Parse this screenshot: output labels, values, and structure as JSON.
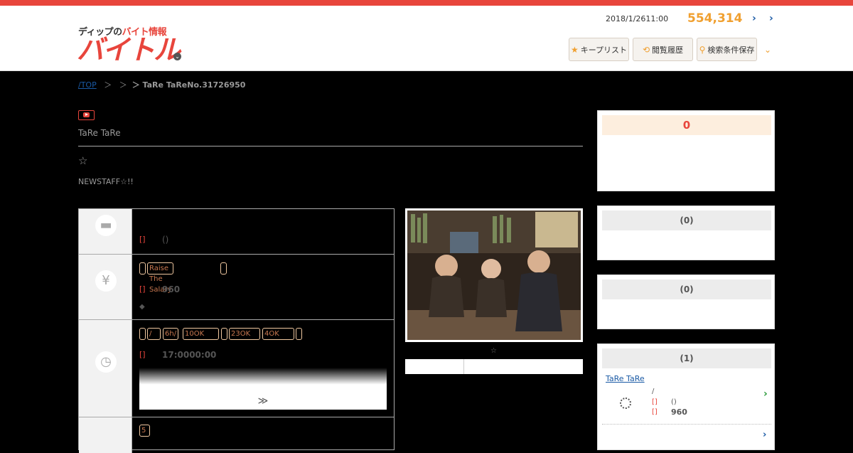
{
  "header": {
    "logo_sub_prefix": "ディップの",
    "logo_sub_red": "バイト情報",
    "logo_main": "バイトル",
    "logo_chevron": "⌄",
    "datetime": "2018/1/2611:00",
    "job_count": "554,314",
    "arrow_1": "›",
    "arrow_2": "›",
    "buttons": [
      {
        "icon": "star-icon",
        "glyph": "★",
        "label": "キープリスト"
      },
      {
        "icon": "history-icon",
        "glyph": "⟲",
        "label": "閲覧履歴"
      },
      {
        "icon": "search-icon",
        "glyph": "⚲",
        "label": "検索条件保存"
      }
    ],
    "dropdown": "⌄"
  },
  "breadcrumb": {
    "top": "/TOP",
    "sep1": "＞",
    "sep2": "＞",
    "current": "＞ TaRe TaReNo.31726950"
  },
  "job": {
    "company": "TaRe TaRe",
    "star": "☆",
    "catch": "NEWSTAFF☆!!"
  },
  "info": {
    "rows": [
      {
        "icon": "briefcase-icon",
        "glyph": "▬",
        "label": "[]",
        "value": "()"
      },
      {
        "icon": "yen-icon",
        "glyph": "¥",
        "tags": [
          "",
          "Raise The Salary",
          ""
        ],
        "label": "[]",
        "value": "960",
        "extra": "◆"
      },
      {
        "icon": "clock-icon",
        "glyph": "◷",
        "tags": [
          "",
          "/",
          "6h/",
          "10OK",
          "",
          "23OK",
          "4OK",
          ""
        ],
        "label": "[]",
        "value": "17:0000:00",
        "more": "≫"
      },
      {
        "icon": "calendar-icon",
        "glyph": "",
        "tags": [
          "5"
        ]
      }
    ]
  },
  "photo": {
    "caption": "☆"
  },
  "sidebar": {
    "keep_count": "0",
    "card2_title": "(0)",
    "card3_title": "(0)",
    "card4_title": "(1)",
    "job": {
      "name": "TaRe TaRe",
      "line1": "/",
      "label1": "[]",
      "value1": "()",
      "label2": "[]",
      "value2": "960",
      "chevron": "›",
      "more": "›"
    }
  },
  "colors": {
    "accent": "#e8453c",
    "orange": "#f0a030",
    "link": "#1a5aa5"
  }
}
